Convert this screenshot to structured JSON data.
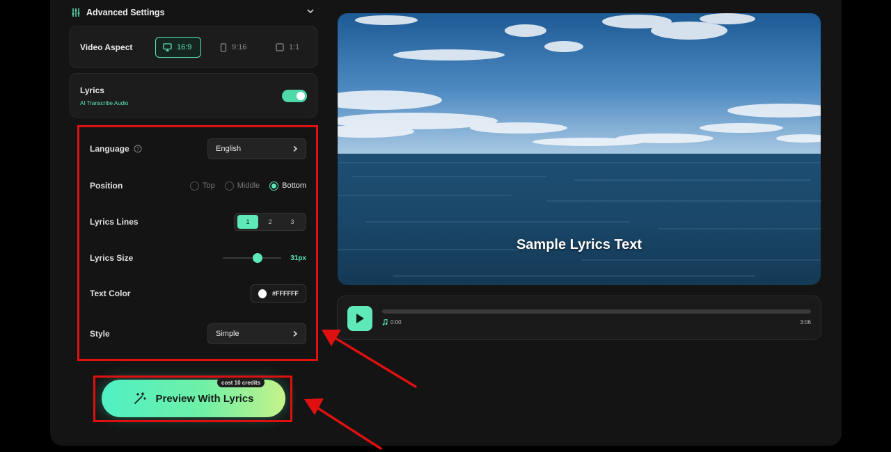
{
  "advanced_settings": {
    "title": "Advanced Settings"
  },
  "video_aspect": {
    "label": "Video Aspect",
    "options": [
      "16:9",
      "9:16",
      "1:1"
    ],
    "selected": "16:9"
  },
  "lyrics": {
    "label": "Lyrics",
    "subtitle": "AI Transcribe Audio",
    "enabled": true
  },
  "settings": {
    "language": {
      "label": "Language",
      "value": "English"
    },
    "position": {
      "label": "Position",
      "options": [
        "Top",
        "Middle",
        "Bottom"
      ],
      "selected": "Bottom"
    },
    "lyrics_lines": {
      "label": "Lyrics Lines",
      "options": [
        "1",
        "2",
        "3"
      ],
      "selected": "1"
    },
    "lyrics_size": {
      "label": "Lyrics Size",
      "value": "31px",
      "level": 0.6
    },
    "text_color": {
      "label": "Text Color",
      "value": "#FFFFFF"
    },
    "style": {
      "label": "Style",
      "value": "Simple"
    }
  },
  "preview_button": {
    "label": "Preview With Lyrics",
    "cost": "cost 10 credits"
  },
  "video_preview": {
    "lyric_text": "Sample Lyrics Text"
  },
  "player": {
    "current_time": "0:00",
    "duration": "3:06",
    "progress": 0
  },
  "colors": {
    "accent": "#5fe8b8",
    "annotation": "#e01010",
    "background": "#141414"
  }
}
